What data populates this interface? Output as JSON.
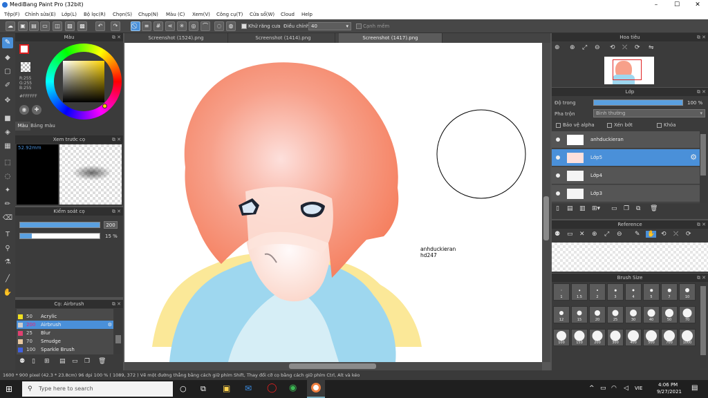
{
  "app": {
    "title": "MediBang Paint Pro (32bit)",
    "window_controls": [
      "–",
      "☐",
      "✕"
    ]
  },
  "menu": [
    "Tệp(F)",
    "Chỉnh sửa(E)",
    "Lớp(L)",
    "Bộ lọc(R)",
    "Chọn(S)",
    "Chụp(N)",
    "Màu (C)",
    "Xem(V)",
    "Công cụ(T)",
    "Cửa sổ(W)",
    "Cloud",
    "Help"
  ],
  "toolbar": {
    "antialias_label": "Khử răng cưa",
    "correction_label": "Điều chỉnh",
    "correction_value": "40",
    "soft_edge_label": "Cạnh mềm"
  },
  "color_panel": {
    "title": "Màu",
    "r": "R:255",
    "g": "G:255",
    "b": "B:255",
    "hex": "#FFFFFF",
    "tab_color": "Màu",
    "tab_palette": "Bảng màu"
  },
  "brush_preview": {
    "title": "Xem trước cọ",
    "size": "52.92mm"
  },
  "brush_control": {
    "title": "Kiểm soát cọ",
    "size_value": "200",
    "size_fill": 1.0,
    "opacity_value": "15 %",
    "opacity_fill": 0.15
  },
  "brush_list": {
    "title": "Cọ: Airbrush",
    "items": [
      {
        "size": "50",
        "name": "Acrylic",
        "color": "#f0e020"
      },
      {
        "size": "200",
        "name": "Airbrush",
        "color": "#cccccc",
        "selected": true
      },
      {
        "size": "25",
        "name": "Blur",
        "color": "#e04070"
      },
      {
        "size": "70",
        "name": "Smudge",
        "color": "#e8c8a0"
      },
      {
        "size": "100",
        "name": "Sparkle Brush",
        "color": "#4060e0"
      }
    ]
  },
  "doc_tabs": [
    "Screenshot (1524).png",
    "Screenshot (1414).png",
    "Screenshot (1417).png"
  ],
  "canvas_text": {
    "line1": "anhduckieran",
    "line2": "hd247"
  },
  "navigator": {
    "title": "Hoa tiêu"
  },
  "layer_panel": {
    "title": "Lớp",
    "opacity_label": "Độ trong",
    "opacity_value": "100 %",
    "opacity_fill": 1.0,
    "blend_label": "Pha trộn",
    "blend_value": "Bình thường",
    "protect_alpha": "Bảo vệ alpha",
    "clipping": "Xén bớt",
    "lock": "Khóa",
    "layers": [
      {
        "name": "anhduckieran",
        "selected": false
      },
      {
        "name": "Lớp5",
        "selected": true
      },
      {
        "name": "Lớp4",
        "selected": false
      },
      {
        "name": "Lớp3",
        "selected": false
      }
    ]
  },
  "reference": {
    "title": "Reference"
  },
  "brush_size": {
    "title": "Brush Size",
    "sizes": [
      "1",
      "1.5",
      "2",
      "3",
      "4",
      "5",
      "7",
      "10",
      "12",
      "15",
      "20",
      "25",
      "30",
      "40",
      "50",
      "70",
      "100",
      "150",
      "200",
      "300",
      "400",
      "500",
      "700",
      "1000"
    ]
  },
  "status": "1600 * 900 pixel   (42.3 * 23.8cm)   96 dpi   100 %   ( 1089, 372 )   Vẽ một đường thẳng bằng cách giữ phím Shift, Thay đổi cỡ cọ bằng cách giữ phím Ctrl, Alt và kéo",
  "taskbar": {
    "search_placeholder": "Type here to search",
    "lang": "VIE",
    "time": "4:06 PM",
    "date": "9/27/2021"
  }
}
